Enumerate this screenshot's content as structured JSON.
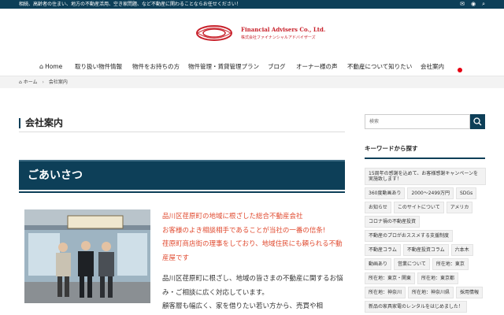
{
  "topbar": {
    "message": "相続、高齢者の住まい、地方の不動産活用、空き家問題、など不動産に関わることならお任せください！",
    "icons": [
      "mail-icon",
      "rss-icon",
      "search-icon"
    ]
  },
  "logo": {
    "name": "Financial Advisers Co., Ltd.",
    "sub": "株式会社ファイナンシャルアドバイザーズ"
  },
  "nav": {
    "items": [
      {
        "label": "Home"
      },
      {
        "label": "取り扱い物件情報"
      },
      {
        "label": "物件をお持ちの方"
      },
      {
        "label": "物件管理・賃貸管理プラン"
      },
      {
        "label": "ブログ"
      },
      {
        "label": "オーナー様の声"
      },
      {
        "label": "不動産について知りたい"
      },
      {
        "label": "会社案内"
      }
    ],
    "active": "会社案内",
    "dot_color": "#e60012"
  },
  "breadcrumb": {
    "home": "ホーム",
    "current": "会社案内"
  },
  "main": {
    "title": "会社案内",
    "section_heading": "ごあいさつ",
    "highlight": [
      "品川区荏原町の地域に根ざした総合不動産会社",
      "お客様のよき相談相手であることが当社の一番の信条!",
      "荏原町商店街の理事をしており、地域住民にも頼られる不動産屋です"
    ],
    "body": [
      "品川区荏原町に根ざし、地域の皆さまの不動産に関するお悩み・ご相談に広く対応しています。",
      "顧客層も幅広く、家を借りたい若い方から、売買や相"
    ]
  },
  "sidebar": {
    "search_placeholder": "検索",
    "keywords_title": "キーワードから探す",
    "tags": [
      "15周年の感謝を込めて、お客様感謝キャンペーンを実施致します！",
      "360度動画あり",
      "2000～2499万円",
      "SDGs",
      "お知らせ",
      "このサイトについて",
      "アメリカ",
      "コロナ禍の不動産投資",
      "不動産のプロがおススメする支援制度",
      "不動産コラム",
      "不動産投資コラム",
      "六本木",
      "動画あり",
      "営業について",
      "所在地：東京",
      "所在地：東京・関東",
      "所在地：東京都",
      "所在地：神奈川",
      "所在地：神奈川県",
      "採用情報",
      "新品の家具家電のレンタルをはじめました！"
    ]
  },
  "colors": {
    "brand_navy": "#0d3f58",
    "accent_red": "#c8202a",
    "highlight_text": "#e04a2f"
  }
}
